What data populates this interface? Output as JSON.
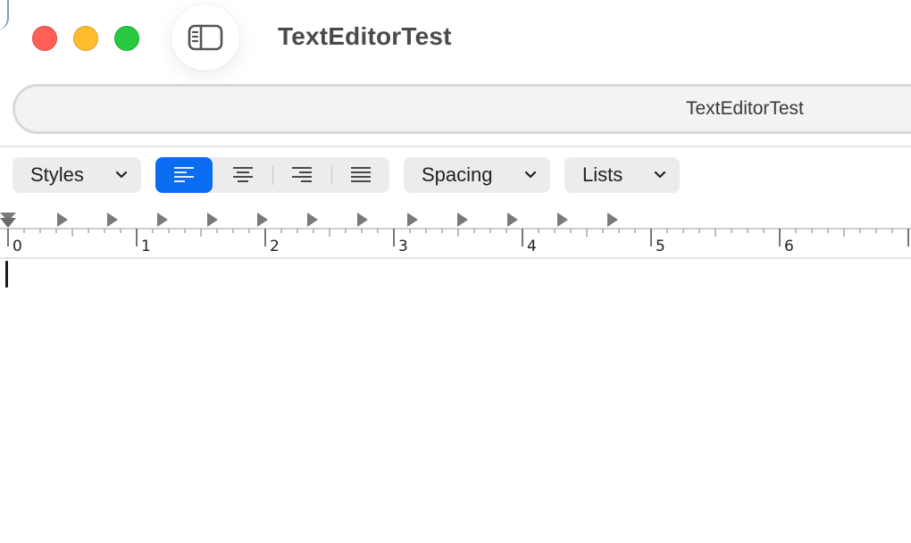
{
  "window": {
    "title": "TextEditorTest",
    "tab_title": "TextEditorTest"
  },
  "toolbar": {
    "styles_label": "Styles",
    "spacing_label": "Spacing",
    "lists_label": "Lists",
    "alignment_options": [
      "align-left",
      "align-center",
      "align-right",
      "align-justify"
    ],
    "selected_alignment": "align-left"
  },
  "ruler": {
    "numbers": [
      "0",
      "1",
      "2",
      "3",
      "4",
      "5",
      "6"
    ]
  },
  "colors": {
    "accent": "#0a6cf0",
    "close": "#ff5f57",
    "minimize": "#febc2e",
    "zoom": "#28c840"
  },
  "editor": {
    "content": ""
  }
}
